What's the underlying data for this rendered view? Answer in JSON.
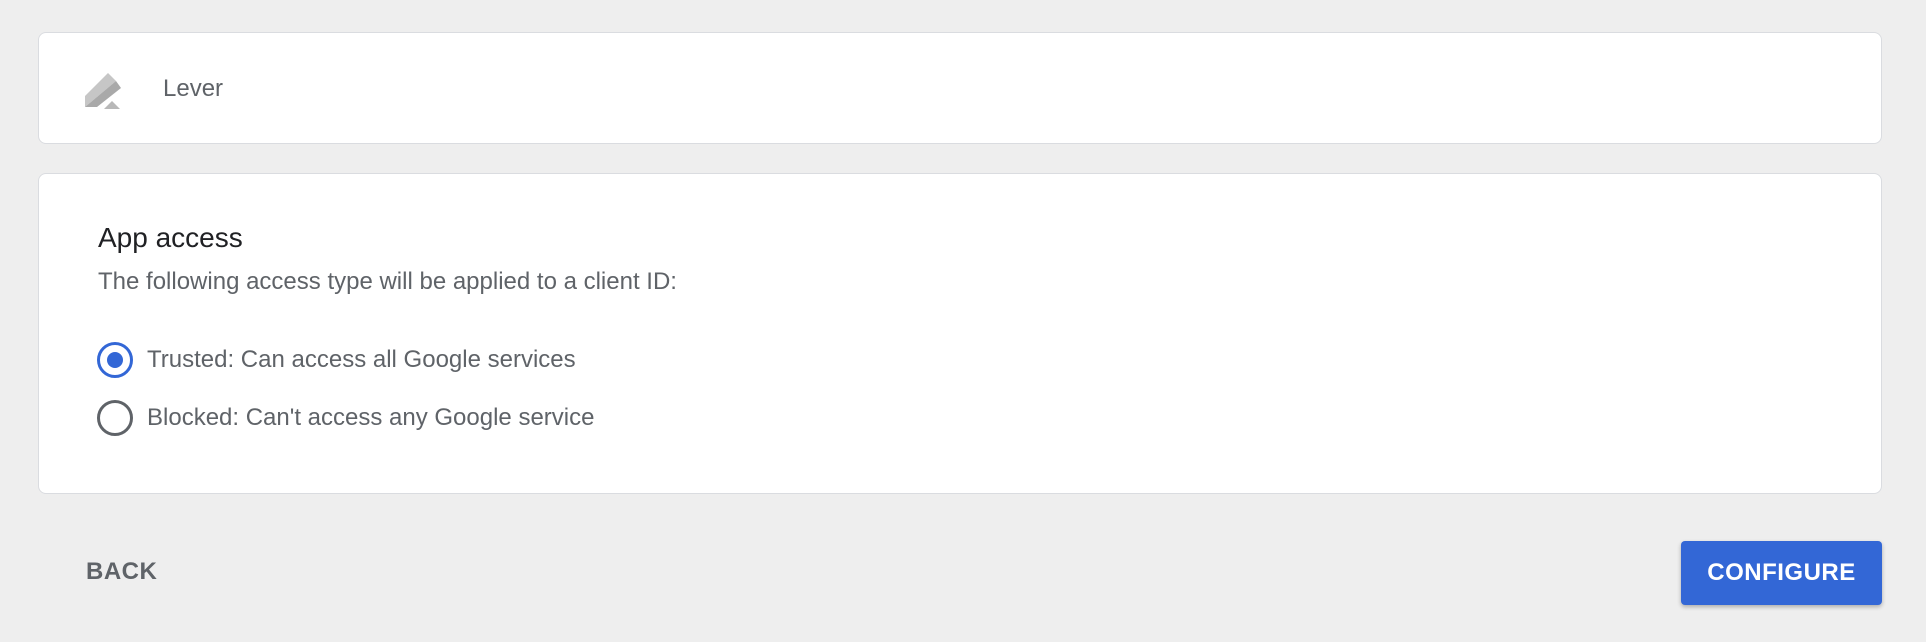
{
  "app": {
    "name": "Lever",
    "logo_icon": "lever-logo-icon"
  },
  "access": {
    "title": "App access",
    "description": "The following access type will be applied to a client ID:",
    "options": [
      {
        "label": "Trusted: Can access all Google services",
        "selected": true
      },
      {
        "label": "Blocked: Can't access any Google service",
        "selected": false
      }
    ]
  },
  "actions": {
    "back_label": "BACK",
    "configure_label": "CONFIGURE"
  },
  "colors": {
    "background": "#eeeeee",
    "accent": "#3367d6",
    "text_secondary": "#5f6368"
  }
}
